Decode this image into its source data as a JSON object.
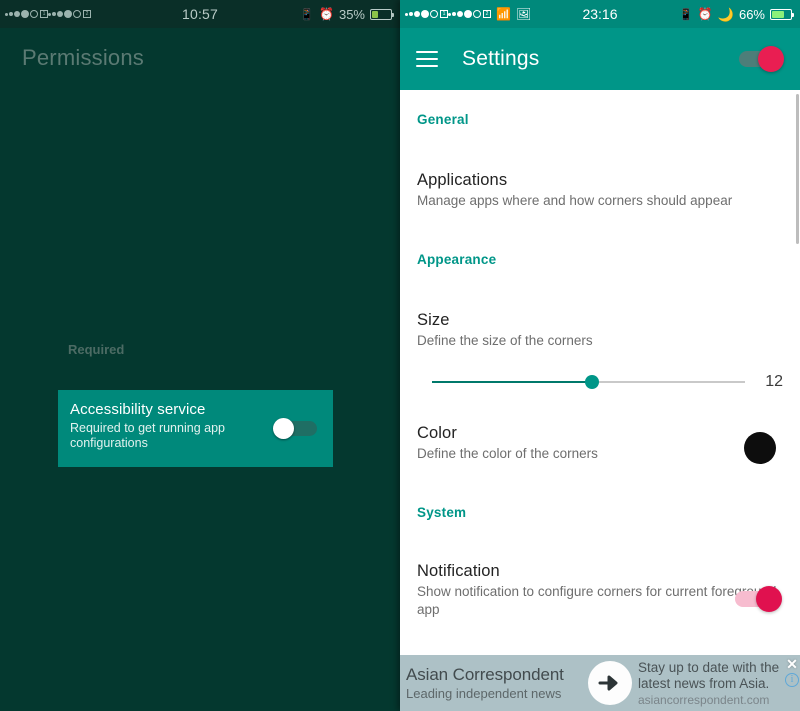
{
  "left_panel": {
    "status_bar": {
      "time": "10:57",
      "battery_percent": "35%",
      "battery_level": 35,
      "icons": [
        "signal-sim1-icon",
        "signal-sim2-icon",
        "vibrate-icon",
        "alarm-icon",
        "battery-icon"
      ]
    },
    "title": "Permissions",
    "section_label": "Required",
    "permission_card": {
      "title": "Accessibility service",
      "subtitle": "Required to get running app configurations",
      "toggle_state": "off",
      "card_color": "#00897b"
    },
    "background_color": "#04382f"
  },
  "right_panel": {
    "status_bar": {
      "time": "23:16",
      "battery_percent": "66%",
      "battery_level": 66,
      "icons": [
        "signal-sim1-icon",
        "signal-sim2-icon",
        "wifi-icon",
        "screenshot-icon",
        "vibrate-icon",
        "alarm-icon",
        "do-not-disturb-icon",
        "battery-icon"
      ]
    },
    "toolbar": {
      "menu_icon": "hamburger-menu-icon",
      "title": "Settings",
      "master_toggle_state": "on",
      "accent_color": "#009688",
      "toggle_thumb_color": "#e91e52"
    },
    "sections": [
      {
        "header": "General",
        "items": [
          {
            "title": "Applications",
            "subtitle": "Manage apps where and how corners should appear",
            "control": "none"
          }
        ]
      },
      {
        "header": "Appearance",
        "items": [
          {
            "title": "Size",
            "subtitle": "Define the size of the corners",
            "control": "slider",
            "slider_value": "12",
            "slider_percent": 51
          },
          {
            "title": "Color",
            "subtitle": "Define the color of the corners",
            "control": "color-swatch",
            "swatch_color": "#0d0d0d"
          }
        ]
      },
      {
        "header": "System",
        "items": [
          {
            "title": "Notification",
            "subtitle": "Show notification to configure corners for current foreground app",
            "control": "switch",
            "toggle_state": "on"
          }
        ]
      }
    ]
  },
  "ad_banner": {
    "headline": "Asian Correspondent",
    "subline": "Leading independent news",
    "cta_icon": "arrow-right-icon",
    "copy": "Stay up to date with the latest news from Asia.",
    "domain": "asiancorrespondent.com",
    "close_label": "✕",
    "info_label": "i"
  }
}
